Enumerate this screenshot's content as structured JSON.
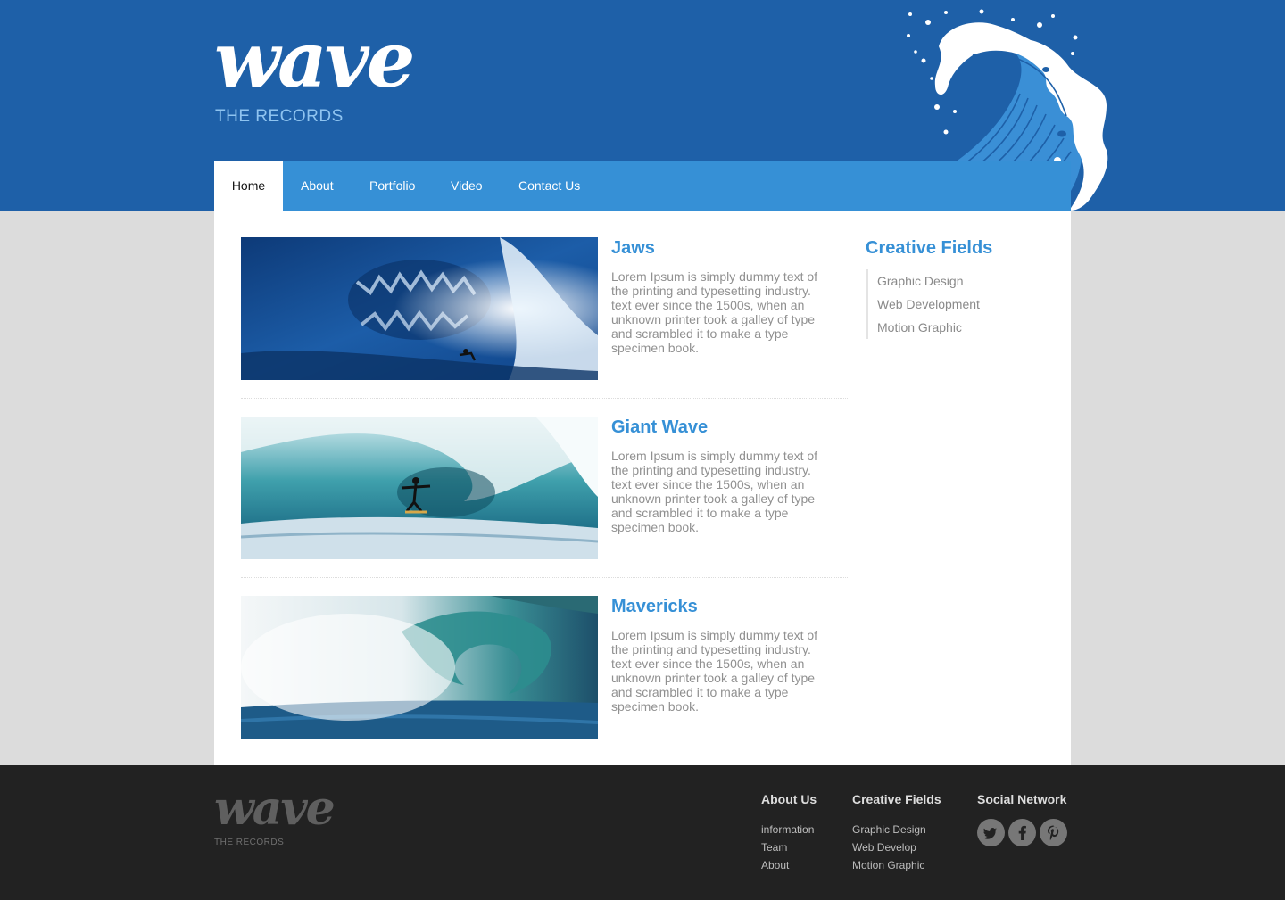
{
  "brand": {
    "logo": "wave",
    "tagline": "THE RECORDS"
  },
  "nav": [
    {
      "label": "Home"
    },
    {
      "label": "About"
    },
    {
      "label": "Portfolio"
    },
    {
      "label": "Video"
    },
    {
      "label": "Contact Us"
    }
  ],
  "posts": [
    {
      "title": "Jaws",
      "text": "Lorem Ipsum is simply dummy text of the printing and typesetting industry. text ever since the 1500s, when an unknown printer took a galley of type and scrambled it to make a type specimen book."
    },
    {
      "title": "Giant Wave",
      "text": "Lorem Ipsum is simply dummy text of the printing and typesetting industry. text ever since the 1500s, when an unknown printer took a galley of type and scrambled it to make a type specimen book."
    },
    {
      "title": "Mavericks",
      "text": "Lorem Ipsum is simply dummy text of the printing and typesetting industry. text ever since the 1500s, when an unknown printer took a galley of type and scrambled it to make a type specimen book."
    }
  ],
  "sidebar": {
    "title": "Creative Fields",
    "items": [
      "Graphic Design",
      "Web Development",
      "Motion Graphic"
    ]
  },
  "footer": {
    "logo": "wave",
    "tagline": "THE RECORDS",
    "about": {
      "title": "About Us",
      "links": [
        "information",
        "Team",
        "About"
      ]
    },
    "fields": {
      "title": "Creative Fields",
      "links": [
        "Graphic Design",
        "Web Develop",
        "Motion Graphic"
      ]
    },
    "social": {
      "title": "Social Network",
      "icons": [
        "twitter-icon",
        "facebook-icon",
        "pinterest-icon"
      ]
    }
  },
  "colors": {
    "header_blue": "#1e60a8",
    "nav_blue": "#3690d6",
    "accent": "#3690d6",
    "footer_bg": "#222222",
    "page_bg": "#dcdcdc"
  }
}
